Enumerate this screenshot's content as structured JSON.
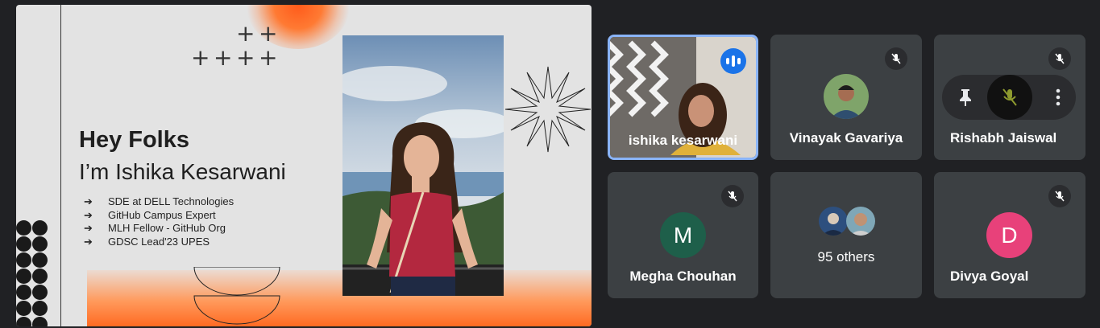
{
  "slide": {
    "heading": "Hey Folks",
    "subheading": "I’m Ishika Kesarwani",
    "bullets": [
      {
        "arrow": "➔",
        "text": "SDE at DELL Technologies"
      },
      {
        "arrow": "➔",
        "text": "GitHub Campus Expert"
      },
      {
        "arrow": "➔",
        "text": "MLH Fellow - GitHub Org"
      },
      {
        "arrow": "➔",
        "text": "GDSC Lead'23 UPES"
      }
    ]
  },
  "participants": [
    {
      "name": "ishika kesarwani",
      "status": "speaking"
    },
    {
      "name": "Vinayak Gavariya",
      "status": "muted"
    },
    {
      "name": "Rishabh Jaiswal",
      "status": "muted"
    },
    {
      "name": "Megha Chouhan",
      "initial": "M",
      "status": "muted",
      "avatar_color": "#1e5f4a"
    },
    {
      "name": "95 others",
      "status": "group"
    },
    {
      "name": "Divya Goyal",
      "initial": "D",
      "status": "muted",
      "avatar_color": "#e8417a"
    }
  ],
  "colors": {
    "background": "#202124",
    "tile": "#3c4043",
    "active_border": "#8ab4f8",
    "speaking_badge": "#1a73e8"
  }
}
